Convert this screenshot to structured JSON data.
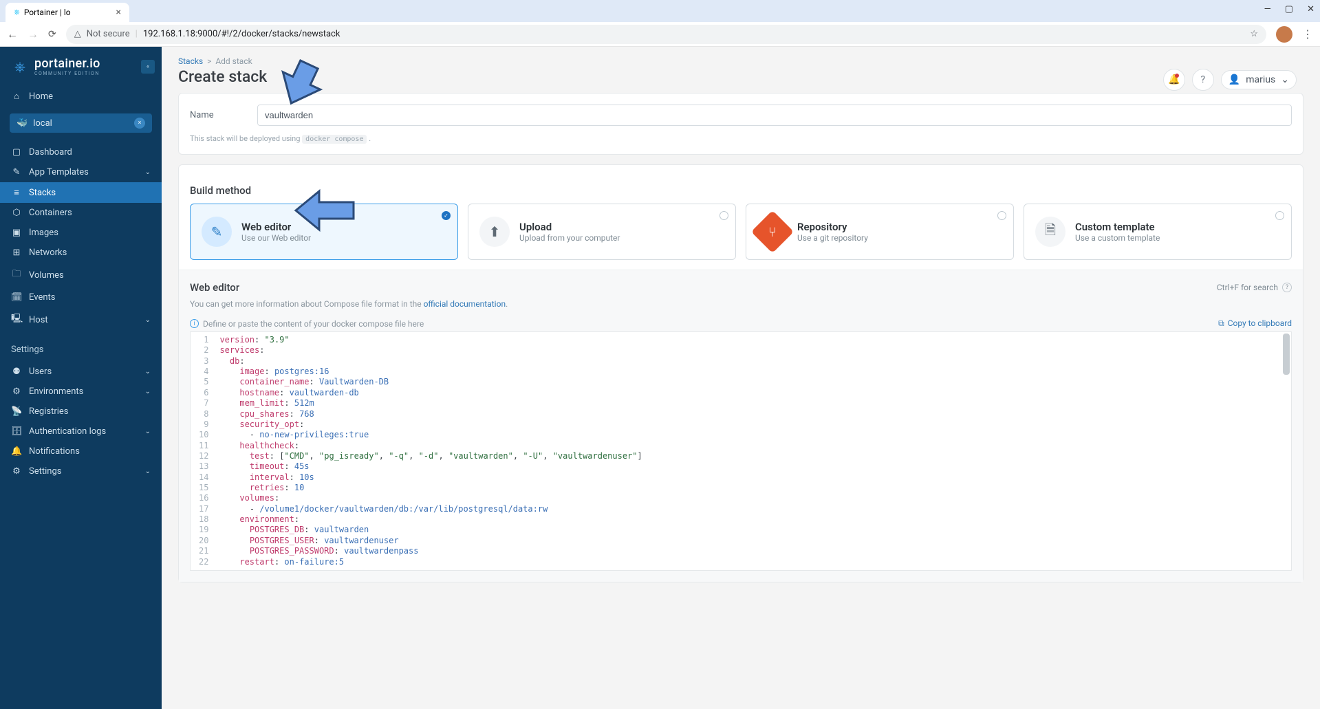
{
  "browser": {
    "tab_title": "Portainer | lo",
    "not_secure": "Not secure",
    "url": "192.168.1.18:9000/#!/2/docker/stacks/newstack"
  },
  "sidebar": {
    "brand": "portainer.io",
    "edition": "COMMUNITY EDITION",
    "home": "Home",
    "env_name": "local",
    "nav1": [
      {
        "icon": "▢",
        "label": "Dashboard"
      },
      {
        "icon": "✎",
        "label": "App Templates",
        "chev": true
      },
      {
        "icon": "≡",
        "label": "Stacks",
        "active": true
      },
      {
        "icon": "⬡",
        "label": "Containers"
      },
      {
        "icon": "▣",
        "label": "Images"
      },
      {
        "icon": "⊞",
        "label": "Networks"
      },
      {
        "icon": "🗀",
        "label": "Volumes"
      },
      {
        "icon": "🗓",
        "label": "Events"
      },
      {
        "icon": "🖳",
        "label": "Host",
        "chev": true
      }
    ],
    "settings_header": "Settings",
    "nav2": [
      {
        "icon": "⚉",
        "label": "Users",
        "chev": true
      },
      {
        "icon": "⚙",
        "label": "Environments",
        "chev": true
      },
      {
        "icon": "📡",
        "label": "Registries"
      },
      {
        "icon": "🗄",
        "label": "Authentication logs",
        "chev": true
      },
      {
        "icon": "🔔",
        "label": "Notifications"
      },
      {
        "icon": "⚙",
        "label": "Settings",
        "chev": true
      }
    ]
  },
  "header": {
    "breadcrumb_stacks": "Stacks",
    "breadcrumb_sep": ">",
    "breadcrumb_add": "Add stack",
    "title": "Create stack",
    "user": "marius"
  },
  "form": {
    "name_label": "Name",
    "name_value": "vaultwarden",
    "deploy_note_pre": "This stack will be deployed using ",
    "deploy_note_code": "docker compose",
    "build_method": "Build method",
    "methods": [
      {
        "title": "Web editor",
        "sub": "Use our Web editor",
        "selected": true
      },
      {
        "title": "Upload",
        "sub": "Upload from your computer"
      },
      {
        "title": "Repository",
        "sub": "Use a git repository"
      },
      {
        "title": "Custom template",
        "sub": "Use a custom template"
      }
    ]
  },
  "editor": {
    "title": "Web editor",
    "search_hint": "Ctrl+F for search",
    "note_pre": "You can get more information about Compose file format in the ",
    "note_link": "official documentation",
    "placeholder_hint": "Define or paste the content of your docker compose file here",
    "copy": "Copy to clipboard",
    "line_numbers": [
      "1",
      "2",
      "3",
      "4",
      "5",
      "6",
      "7",
      "8",
      "9",
      "10",
      "11",
      "12",
      "13",
      "14",
      "15",
      "16",
      "17",
      "18",
      "19",
      "20",
      "21",
      "22"
    ]
  }
}
